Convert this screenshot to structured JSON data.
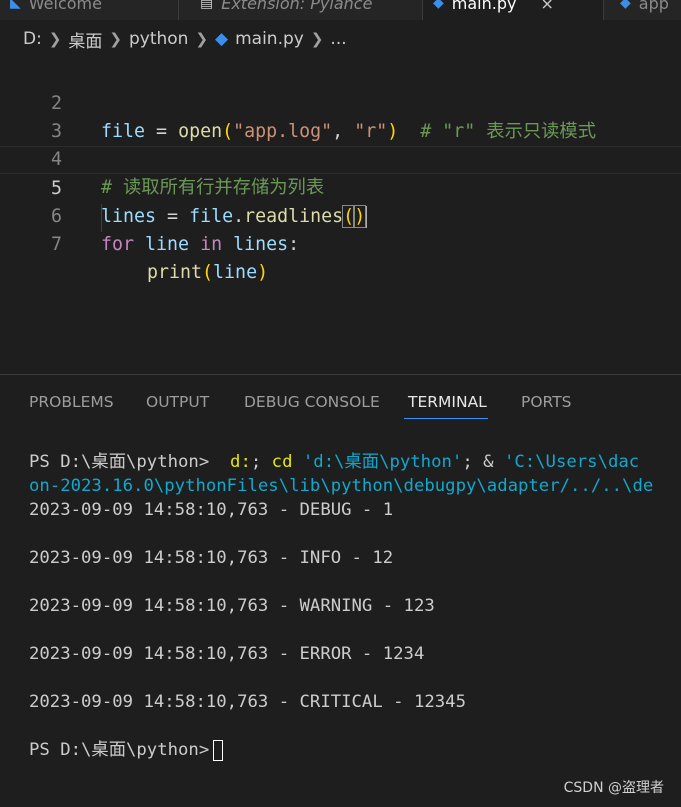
{
  "tabs": [
    {
      "label": "Welcome",
      "icon": "vscode-logo-icon"
    },
    {
      "label": "Extension: Pylance",
      "icon": "extension-icon"
    },
    {
      "label": "main.py",
      "icon": "python-file-icon",
      "close": "×"
    },
    {
      "label": "app",
      "icon": "python-file-icon"
    }
  ],
  "breadcrumb": {
    "drive": "D:",
    "folder1": "桌面",
    "folder2": "python",
    "file": "main.py",
    "more": "..."
  },
  "editor": {
    "line_numbers": [
      "2",
      "3",
      "4",
      "5",
      "6",
      "7"
    ],
    "line2": {
      "var": "file",
      "op": " = ",
      "fn": "open",
      "p1": "(",
      "s1": "\"app.log\"",
      "comma": ", ",
      "s2": "\"r\"",
      "p2": ")",
      "comment": "  # \"r\" 表示只读模式"
    },
    "line4": {
      "comment": "# 读取所有行并存储为列表"
    },
    "line5": {
      "var": "lines",
      "op": " = ",
      "obj": "file",
      "dot": ".",
      "fn": "readlines",
      "p1": "(",
      "p2": ")"
    },
    "line6": {
      "kw1": "for",
      "v1": " line",
      "kw2": " in",
      "v2": " lines",
      "colon": ":"
    },
    "line7": {
      "fn": "print",
      "p1": "(",
      "arg": "line",
      "p2": ")"
    }
  },
  "panel": {
    "tabs": [
      "PROBLEMS",
      "OUTPUT",
      "DEBUG CONSOLE",
      "TERMINAL",
      "PORTS"
    ],
    "active_tab": "TERMINAL"
  },
  "terminal": {
    "prompt1": "PS D:\\桌面\\python>",
    "cmd_a": "  d:",
    "cmd_b": "; ",
    "cmd_c": "cd",
    "cmd_d": " ",
    "cmd_path": "'d:\\桌面\\python'",
    "cmd_e": "; & ",
    "cmd_path2": "'C:\\Users\\dac",
    "line2": "on-2023.16.0\\pythonFiles\\lib\\python\\debugpy\\adapter/../..\\de",
    "log": [
      "2023-09-09 14:58:10,763 - DEBUG - 1",
      "2023-09-09 14:58:10,763 - INFO - 12",
      "2023-09-09 14:58:10,763 - WARNING - 123",
      "2023-09-09 14:58:10,763 - ERROR - 1234",
      "2023-09-09 14:58:10,763 - CRITICAL - 12345"
    ],
    "prompt2": "PS D:\\桌面\\python>"
  },
  "watermark": "CSDN @盗理者"
}
